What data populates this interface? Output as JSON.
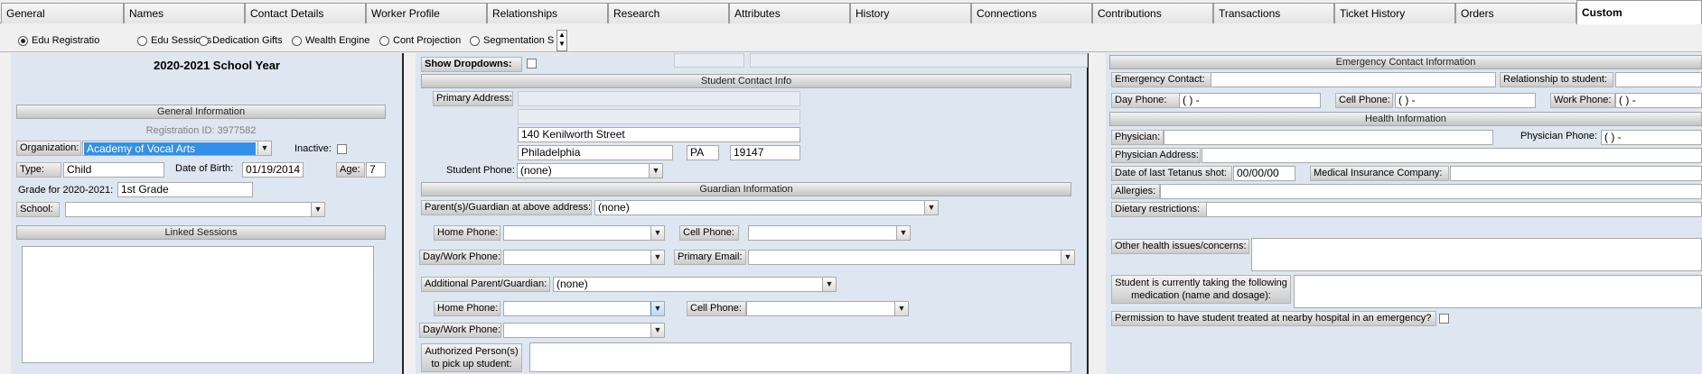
{
  "tabs": [
    "General",
    "Names",
    "Contact Details",
    "Worker Profile",
    "Relationships",
    "Research",
    "Attributes",
    "History",
    "Connections",
    "Contributions",
    "Transactions",
    "Ticket History",
    "Orders",
    "Custom"
  ],
  "active_tab": "Custom",
  "subtabs": [
    "Edu Registratio",
    "Edu Sessions",
    "Dedication Gifts",
    "Wealth Engine",
    "Cont Projection",
    "Segmentation S"
  ],
  "selected_subtab": "Edu Registratio",
  "left": {
    "school_year": "2020-2021 School Year",
    "general_header": "General Information",
    "registration_id": "Registration ID: 3977582",
    "organization_label": "Organization:",
    "organization_value": "Academy of Vocal Arts",
    "inactive_label": "Inactive:",
    "type_label": "Type:",
    "type_value": "Child",
    "dob_label": "Date of Birth:",
    "dob_value": "01/19/2014",
    "age_label": "Age:",
    "age_value": "7",
    "grade_label": "Grade for 2020-2021:",
    "grade_value": "1st Grade",
    "school_label": "School:",
    "school_value": "",
    "linked_header": "Linked Sessions"
  },
  "middle": {
    "show_dropdowns_label": "Show Dropdowns:",
    "contact_header": "Student Contact Info",
    "primary_address_label": "Primary Address:",
    "address_line1": "",
    "address_line2": "",
    "address_line3": "140 Kenilworth Street",
    "city": "Philadelphia",
    "state": "PA",
    "zip": "19147",
    "student_phone_label": "Student Phone:",
    "student_phone_value": "(none)",
    "guardian_header": "Guardian Information",
    "parent_label": "Parent(s)/Guardian at above address:",
    "parent_value": "(none)",
    "home_phone_label": "Home Phone:",
    "cell_phone_label": "Cell Phone:",
    "daywork_phone_label": "Day/Work Phone:",
    "primary_email_label": "Primary Email:",
    "additional_label": "Additional Parent/Guardian:",
    "additional_value": "(none)",
    "home_phone2_label": "Home Phone:",
    "cell_phone2_label": "Cell Phone:",
    "daywork_phone2_label": "Day/Work Phone:",
    "authorized_label_1": "Authorized Person(s)",
    "authorized_label_2": "to pick up student:"
  },
  "right": {
    "emergency_header": "Emergency Contact Information",
    "emergency_contact_label": "Emergency Contact:",
    "relationship_label": "Relationship to student:",
    "day_phone_label": "Day Phone:",
    "day_phone_value": "(   )    -",
    "cell_phone_label": "Cell Phone:",
    "cell_phone_value": "(   )    -",
    "work_phone_label": "Work Phone:",
    "work_phone_value": "(   )    -",
    "health_header": "Health Information",
    "physician_label": "Physician:",
    "physician_phone_label": "Physician Phone:",
    "physician_phone_value": "(   )    -",
    "physician_address_label": "Physician Address:",
    "tetanus_label": "Date of last Tetanus shot:",
    "tetanus_value": "00/00/00",
    "insurance_label": "Medical Insurance Company:",
    "allergies_label": "Allergies:",
    "dietary_label": "Dietary restrictions:",
    "other_health_label": "Other health issues/concerns:",
    "medication_label_1": "Student is currently taking the following",
    "medication_label_2": "medication (name and dosage):",
    "permission_label": "Permission to have student treated at nearby hospital in an emergency?"
  }
}
